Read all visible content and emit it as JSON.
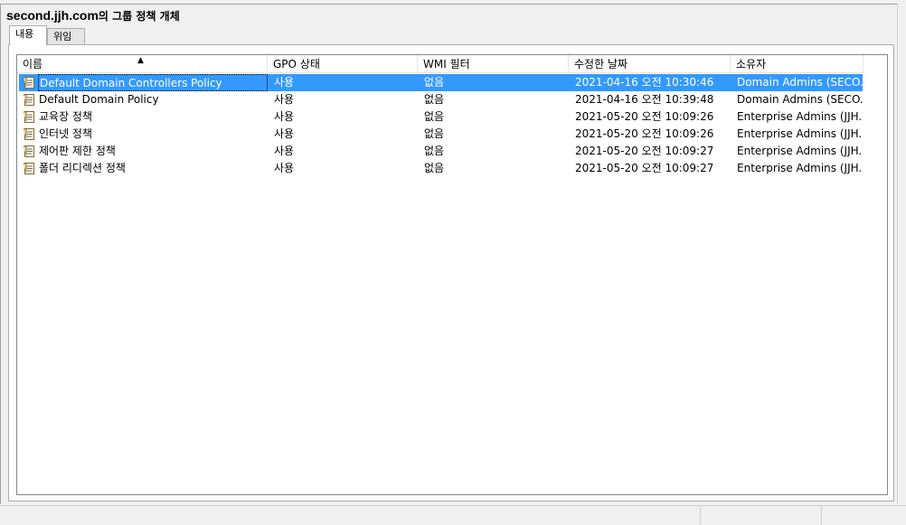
{
  "header": {
    "domain": "second.jjh.com",
    "suffix": "의 그룹 정책 개체"
  },
  "tabs": [
    {
      "label": "내용",
      "selected": true
    },
    {
      "label": "위임",
      "selected": false
    }
  ],
  "columns": [
    "이름",
    "GPO 상태",
    "WMI 필터",
    "수정한 날짜",
    "소유자"
  ],
  "sort": {
    "column": "이름",
    "direction": "ascending"
  },
  "rows": [
    {
      "name": "Default Domain Controllers Policy",
      "status": "사용",
      "wmi": "없음",
      "modified": "2021-04-16 오전 10:30:46",
      "owner": "Domain Admins (SECO...",
      "selected": true
    },
    {
      "name": "Default Domain Policy",
      "status": "사용",
      "wmi": "없음",
      "modified": "2021-04-16 오전 10:39:48",
      "owner": "Domain Admins (SECO...",
      "selected": false
    },
    {
      "name": "교육장 정책",
      "status": "사용",
      "wmi": "없음",
      "modified": "2021-05-20 오전 10:09:26",
      "owner": "Enterprise Admins (JJH...",
      "selected": false
    },
    {
      "name": "인터넷 정책",
      "status": "사용",
      "wmi": "없음",
      "modified": "2021-05-20 오전 10:09:26",
      "owner": "Enterprise Admins (JJH...",
      "selected": false
    },
    {
      "name": "제어판 제한 정책",
      "status": "사용",
      "wmi": "없음",
      "modified": "2021-05-20 오전 10:09:27",
      "owner": "Enterprise Admins (JJH...",
      "selected": false
    },
    {
      "name": "폴더 리디렉션 정책",
      "status": "사용",
      "wmi": "없음",
      "modified": "2021-05-20 오전 10:09:27",
      "owner": "Enterprise Admins (JJH...",
      "selected": false
    }
  ],
  "icons": {
    "gpo": "gpo-scroll-icon",
    "sort": "sort-ascending-icon"
  },
  "colors": {
    "selection": "#3399ff",
    "selection_text": "#ffffff"
  }
}
